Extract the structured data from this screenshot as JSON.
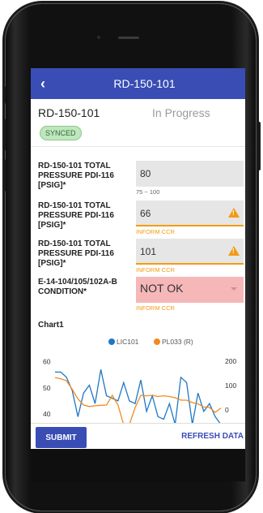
{
  "appbar": {
    "title": "RD-150-101",
    "back_icon": "chevron-left-icon"
  },
  "record": {
    "id": "RD-150-101",
    "status": "In Progress",
    "badge": "SYNCED"
  },
  "fields": [
    {
      "label": "RD-150-101 TOTAL PRESSURE PDI-116 [PSIG]*",
      "value": "80",
      "hint": "75 ~ 100",
      "state": "normal"
    },
    {
      "label": "RD-150-101 TOTAL PRESSURE PDI-116 [PSIG]*",
      "value": "66",
      "hint": "INFORM CCR",
      "state": "warning"
    },
    {
      "label": "RD-150-101 TOTAL PRESSURE PDI-116 [PSIG]*",
      "value": "101",
      "hint": "INFORM CCR",
      "state": "warning"
    },
    {
      "label": "E-14-104/105/102A-B CONDITION*",
      "value": "NOT OK",
      "hint": "INFORM CCR",
      "state": "error"
    }
  ],
  "chart_title": "Chart1",
  "chart_data": {
    "type": "line",
    "series": [
      {
        "name": "LIC101",
        "axis": "left",
        "color": "#1f77c4",
        "values": [
          56,
          56,
          54,
          49,
          39,
          48,
          51,
          44,
          57,
          47,
          46,
          45,
          52,
          45,
          44,
          53,
          41,
          47,
          39,
          38,
          44,
          36,
          54,
          52,
          35,
          48,
          41,
          44,
          39,
          36
        ]
      },
      {
        "name": "PL033 (R)",
        "axis": "right",
        "color": "#f28a1e",
        "values": [
          133,
          128,
          120,
          85,
          45,
          20,
          14,
          17,
          19,
          20,
          60,
          20,
          -60,
          -60,
          10,
          60,
          58,
          60,
          55,
          58,
          55,
          50,
          40,
          40,
          30,
          25,
          12,
          10,
          -10,
          8
        ]
      }
    ],
    "y_left": {
      "ticks": [
        40,
        50,
        60
      ],
      "range": [
        36,
        62
      ]
    },
    "y_right": {
      "ticks": [
        0,
        100,
        200
      ],
      "range": [
        -60,
        220
      ]
    },
    "legend": "top"
  },
  "footer": {
    "submit": "SUBMIT",
    "refresh": "REFRESH DATA"
  },
  "colors": {
    "primary": "#3a4db5",
    "warning": "#f29b13",
    "error_bg": "#f6b7b9",
    "badge_bg": "#bfe6bf"
  }
}
